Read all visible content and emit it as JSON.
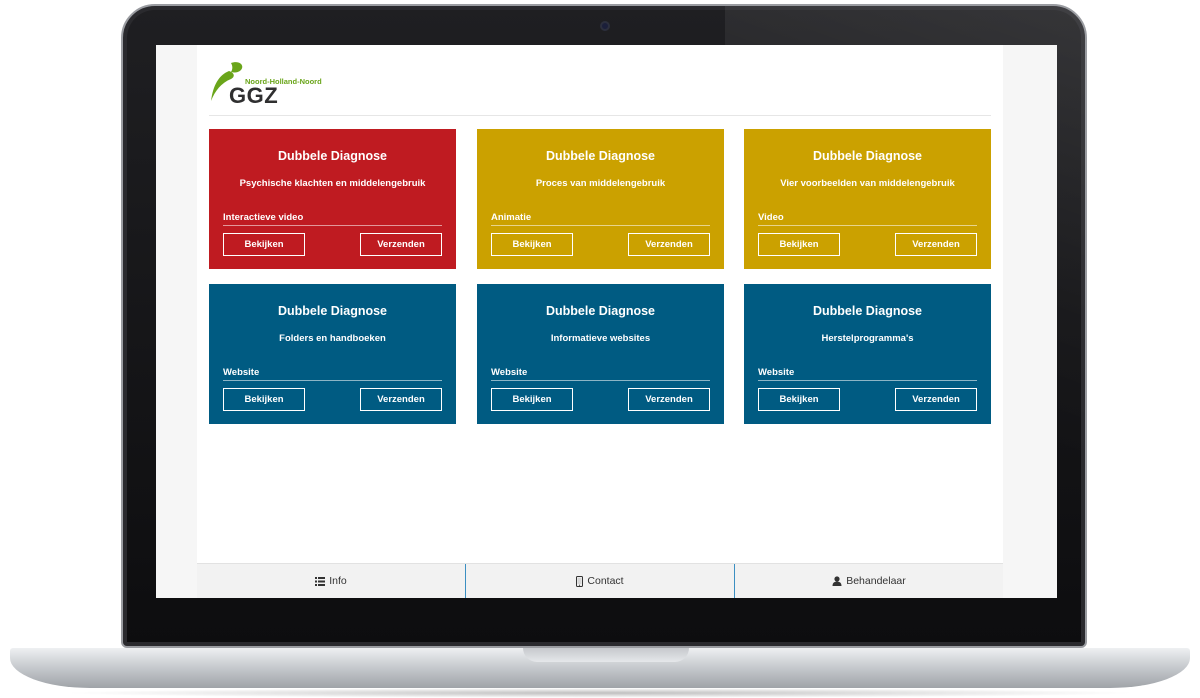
{
  "brand": {
    "logo_text": "GGZ",
    "logo_tagline": "Noord-Holland-Noord",
    "colors": {
      "green": "#6aa51a",
      "dark": "#2f2f30"
    }
  },
  "colors": {
    "red": "#bf1b21",
    "gold": "#cba100",
    "blue": "#005b82",
    "footer_divider": "#3b8fc2"
  },
  "cards": [
    {
      "title": "Dubbele Diagnose",
      "subtitle": "Psychische klachten en middelengebruik",
      "type": "Interactieve video",
      "view_label": "Bekijken",
      "send_label": "Verzenden",
      "color": "red"
    },
    {
      "title": "Dubbele Diagnose",
      "subtitle": "Proces van middelengebruik",
      "type": "Animatie",
      "view_label": "Bekijken",
      "send_label": "Verzenden",
      "color": "gold"
    },
    {
      "title": "Dubbele Diagnose",
      "subtitle": "Vier voorbeelden van middelengebruik",
      "type": "Video",
      "view_label": "Bekijken",
      "send_label": "Verzenden",
      "color": "gold"
    },
    {
      "title": "Dubbele Diagnose",
      "subtitle": "Folders en handboeken",
      "type": "Website",
      "view_label": "Bekijken",
      "send_label": "Verzenden",
      "color": "blue"
    },
    {
      "title": "Dubbele Diagnose",
      "subtitle": "Informatieve websites",
      "type": "Website",
      "view_label": "Bekijken",
      "send_label": "Verzenden",
      "color": "blue"
    },
    {
      "title": "Dubbele Diagnose",
      "subtitle": "Herstelprogramma's",
      "type": "Website",
      "view_label": "Bekijken",
      "send_label": "Verzenden",
      "color": "blue"
    }
  ],
  "footer": {
    "tabs": [
      {
        "label": "Info",
        "icon": "list-icon"
      },
      {
        "label": "Contact",
        "icon": "mobile-phone-icon"
      },
      {
        "label": "Behandelaar",
        "icon": "user-icon"
      }
    ]
  }
}
